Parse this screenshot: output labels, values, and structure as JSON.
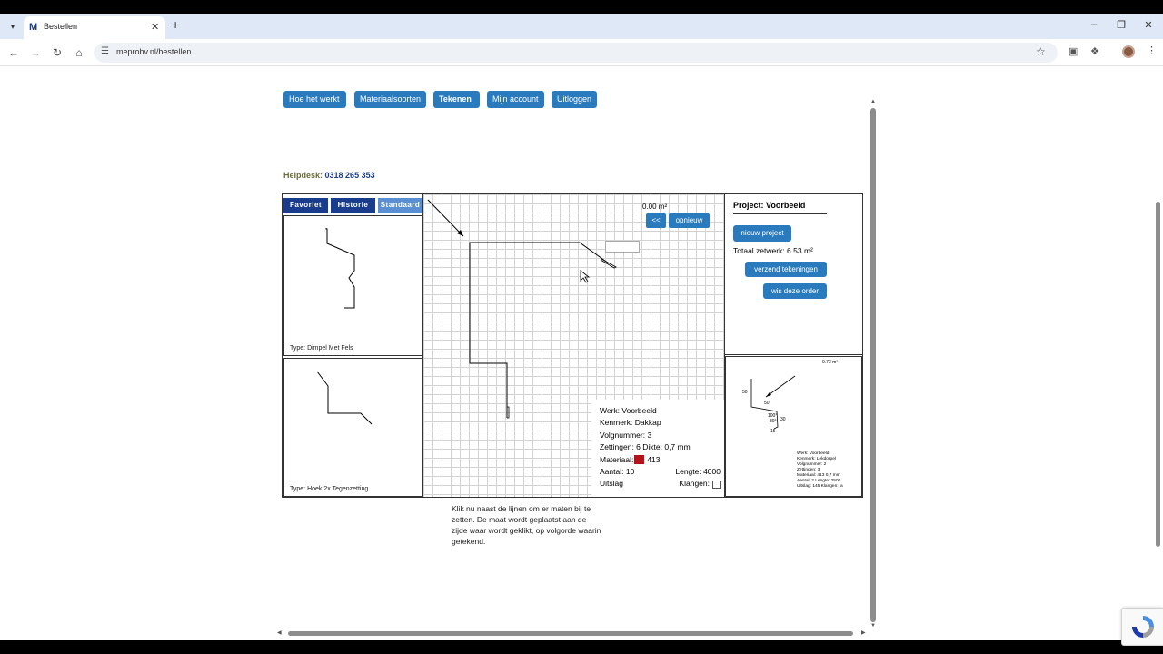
{
  "browser": {
    "tab_title": "Bestellen",
    "url": "meprobv.nl/bestellen"
  },
  "site_nav": [
    "Hoe het werkt",
    "Materiaalsoorten",
    "Tekenen",
    "Mijn account",
    "Uitloggen"
  ],
  "helpdesk": {
    "label": "Helpdesk:",
    "phone": "0318 265 353"
  },
  "left_tabs": [
    "Favoriet",
    "Historie",
    "Standaard"
  ],
  "presets": [
    {
      "label": "Type: Dimpel Met Fels"
    },
    {
      "label": "Type: Hoek 2x Tegenzetting"
    }
  ],
  "canvas": {
    "area": "0.00 m²",
    "back_label": "<<",
    "reset_label": "opnieuw"
  },
  "info": {
    "werk": "Werk: Voorbeeld",
    "kenmerk": "Kenmerk: Dakkap",
    "volgnummer": "Volgnummer: 3",
    "zettingen": "Zettingen: 6  Dikte: 0,7 mm",
    "materiaal_label": "Materiaal:",
    "materiaal_code": "413",
    "aantal": "Aantal: 10",
    "lengte": "Lengte: 4000",
    "uitslag": "Uitslag",
    "klangen": "Klangen:",
    "material_color": "#b5121b"
  },
  "project": {
    "title": "Project: Voorbeeld",
    "new_label": "nieuw project",
    "totaal": "Totaal zetwerk: 6.53 m²",
    "send_label": "verzend tekeningen",
    "clear_label": "wis deze order"
  },
  "thumbnail": {
    "area": "0.73 m²",
    "dims": [
      "50",
      "50",
      "100°",
      "80°",
      "30",
      "15"
    ],
    "info_lines": [
      "Werk: Voorbeeld",
      "Kenmerk: Lekdorpel",
      "Volgnummer: 2",
      "Zettingen: 3",
      "Materiaal: 413 0,7 mm",
      "Aantal: 2       Lengte: 2500",
      "Uitslag: 145  Klangen: ja"
    ]
  },
  "help_text": "Klik nu naast de lijnen om er maten bij te zetten. De maat wordt geplaatst aan de zijde waar wordt geklikt, op volgorde waarin getekend.",
  "colors": {
    "button_blue": "#2a7bbd",
    "tab_dark": "#1a3c8c",
    "tab_light": "#5a8fd4"
  }
}
